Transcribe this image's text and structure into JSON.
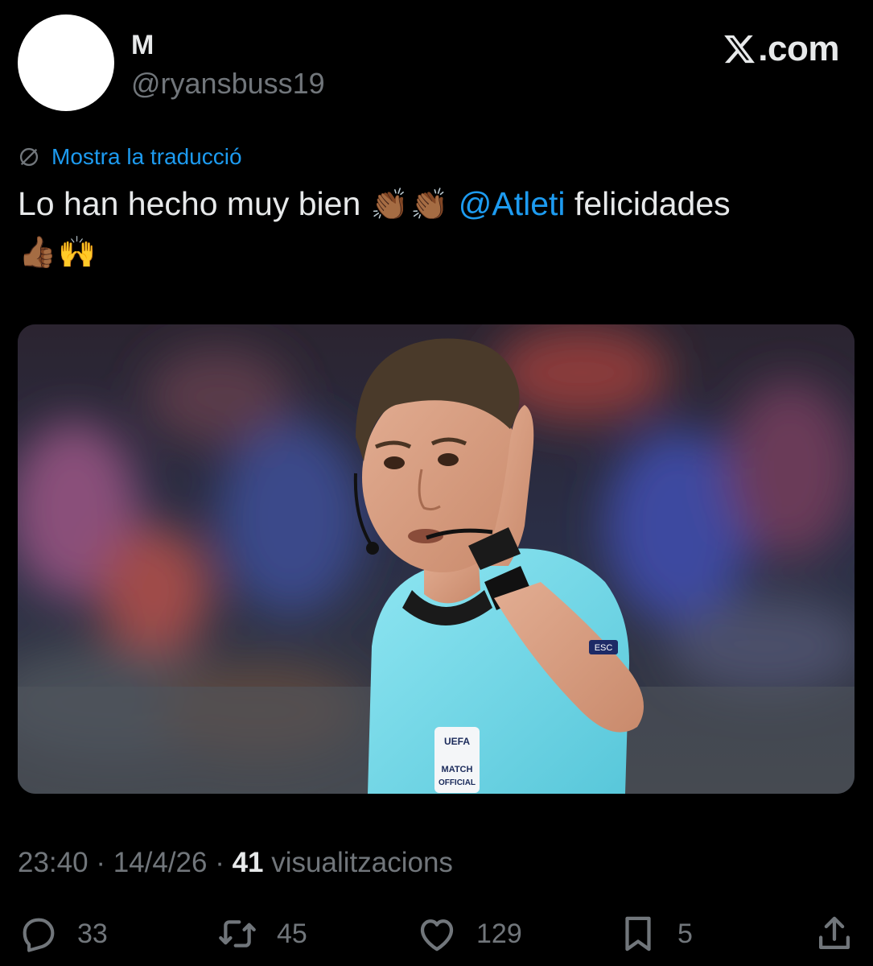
{
  "header": {
    "display_name": "M",
    "handle": "@ryansbuss19",
    "brand_suffix": ".com"
  },
  "translate": {
    "label": "Mostra la traducció"
  },
  "tweet": {
    "text_before": "Lo han hecho muy bien",
    "emoji_clap_1": "👏🏾",
    "emoji_clap_2": "👏🏾",
    "mention": "@Atleti",
    "text_after": "felicidades",
    "emoji_thumbs": "👍🏾",
    "emoji_raised": "🙌"
  },
  "media": {
    "badge_line1": "UEFA",
    "badge_line2": "MATCH",
    "badge_line3": "OFFICIAL",
    "sleeve_text": "ESC"
  },
  "meta": {
    "time": "23:40",
    "sep1": " · ",
    "date": "14/4/26",
    "sep2": " · ",
    "views_count": "41",
    "views_label": " visualitzacions"
  },
  "actions": {
    "replies": "33",
    "reposts": "45",
    "likes": "129",
    "bookmarks": "5"
  },
  "colors": {
    "background": "#000000",
    "text": "#e7e9ea",
    "muted": "#71767b",
    "accent": "#1d9bf0"
  },
  "icons": {
    "translate": "globe-slash-icon",
    "reply": "reply-icon",
    "repost": "repost-icon",
    "like": "heart-icon",
    "bookmark": "bookmark-icon",
    "share": "share-icon",
    "brand": "x-logo-icon"
  }
}
